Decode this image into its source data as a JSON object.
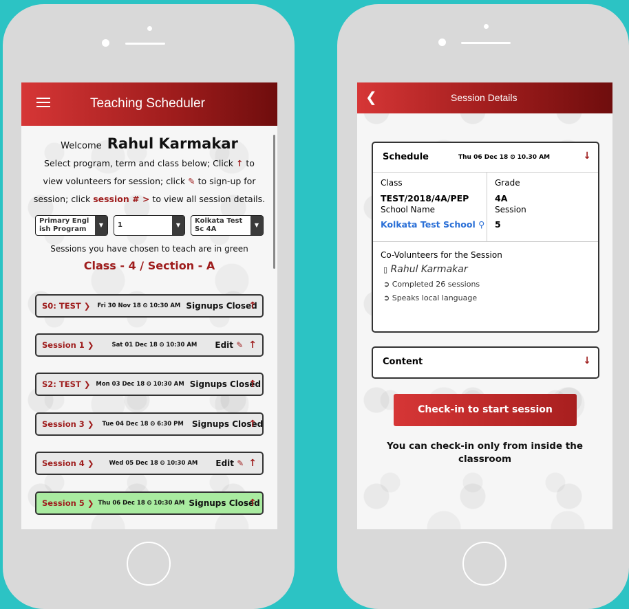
{
  "left_screen": {
    "app_title": "Teaching Scheduler",
    "welcome_prefix": "Welcome",
    "user_name": "Rahul Karmakar",
    "instruction_1": "Select program, term and class below; Click",
    "instruction_1_end": "to",
    "instruction_2": "view volunteers for session; click",
    "instruction_2_end": "to sign-up for",
    "instruction_3": "session; click",
    "instruction_3_link": "session # >",
    "instruction_3_end": "to view all session details.",
    "selects": [
      {
        "line1": "Primary Engl",
        "line2": "ish Program"
      },
      {
        "line1": "1",
        "line2": ""
      },
      {
        "line1": "Kolkata Test",
        "line2": "Sc 4A"
      }
    ],
    "chosen_note": "Sessions you have chosen to teach are in green",
    "class_section": "Class - 4 / Section - A",
    "sessions": [
      {
        "name": "S0: TEST",
        "date": "Fri 30 Nov 18 ⏲ 10:30 AM",
        "status": "Signups Closed"
      },
      {
        "name": "Session 1",
        "date": "Sat 01 Dec 18 ⏲ 10:30 AM",
        "status": "Edit"
      },
      {
        "name": "S2: TEST",
        "date": "Mon 03 Dec 18 ⏲ 10:30 AM",
        "status": "Signups Closed"
      },
      {
        "name": "Session 3",
        "date": "Tue 04 Dec 18 ⏲ 6:30 PM",
        "status": "Signups Closed"
      },
      {
        "name": "Session 4",
        "date": "Wed 05 Dec 18 ⏲ 10:30 AM",
        "status": "Edit"
      },
      {
        "name": "Session 5",
        "date": "Thu 06 Dec 18 ⏲ 10:30 AM",
        "status": "Signups Closed"
      }
    ]
  },
  "right_screen": {
    "app_title": "Session Details",
    "schedule_label": "Schedule",
    "schedule_date": "Thu 06 Dec 18 ⏲ 10.30 AM",
    "class_label": "Class",
    "class_value": "TEST/2018/4A/PEP",
    "school_label": "School Name",
    "school_value": "Kolkata Test School",
    "grade_label": "Grade",
    "grade_value": "4A",
    "session_label": "Session",
    "session_value": "5",
    "covol_title": "Co-Volunteers for the Session",
    "volunteer_name": "Rahul Karmakar",
    "volunteer_info_1": "Completed 26 sessions",
    "volunteer_info_2": "Speaks local language",
    "content_label": "Content",
    "checkin_button": "Check-in to start session",
    "checkin_note": "You can check-in only from inside the classroom"
  },
  "colors": {
    "background": "#2cc3c4",
    "accent": "#9e1c1c",
    "green_row": "#a9eba0",
    "link": "#2a6fd6"
  }
}
